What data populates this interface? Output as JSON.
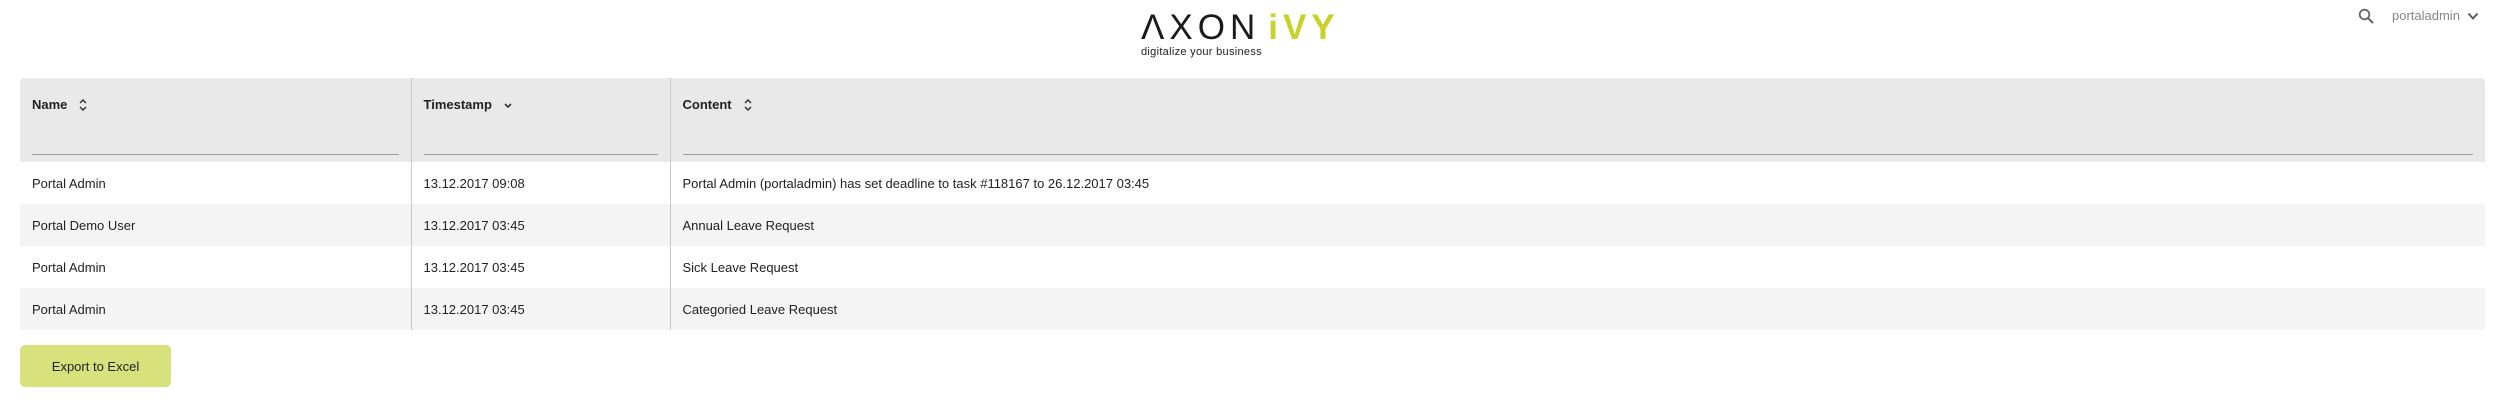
{
  "header": {
    "logo": {
      "word1": "ΛXON",
      "word2": "iVY",
      "tagline": "digitalize your business"
    },
    "user": {
      "name": "portaladmin"
    }
  },
  "table": {
    "columns": [
      {
        "label": "Name",
        "sort_icon": "sort-both-icon",
        "filter_value": ""
      },
      {
        "label": "Timestamp",
        "sort_icon": "sort-descending-icon",
        "filter_value": ""
      },
      {
        "label": "Content",
        "sort_icon": "sort-both-icon",
        "filter_value": ""
      }
    ],
    "rows": [
      [
        "Portal Admin",
        "13.12.2017 09:08",
        "Portal Admin (portaladmin) has set deadline to task #118167 to 26.12.2017 03:45"
      ],
      [
        "Portal Demo User",
        "13.12.2017 03:45",
        "Annual Leave Request"
      ],
      [
        "Portal Admin",
        "13.12.2017 03:45",
        "Sick Leave Request"
      ],
      [
        "Portal Admin",
        "13.12.2017 03:45",
        "Categoried Leave Request"
      ]
    ]
  },
  "actions": {
    "export_label": "Export to Excel"
  },
  "colors": {
    "brand_accent": "#c8d22a",
    "button_bg": "#d7e27c",
    "header_bg": "#e9e9e9",
    "row_alt_bg": "#f4f4f4"
  }
}
